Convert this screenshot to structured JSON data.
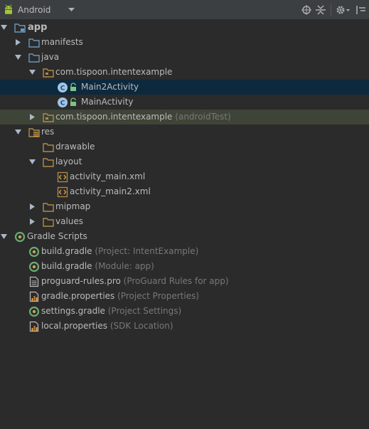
{
  "toolbar": {
    "view_selector": "Android",
    "icons": [
      "android-icon",
      "dropdown-arrow-icon",
      "scroll-to-source-icon",
      "collapse-all-icon",
      "settings-icon",
      "hide-icon"
    ]
  },
  "tree": {
    "app": "app",
    "manifests": "manifests",
    "java": "java",
    "pkg_main": "com.tispoon.intentexample",
    "main2activity": "Main2Activity",
    "mainactivity": "MainActivity",
    "pkg_test": "com.tispoon.intentexample",
    "pkg_test_hint": "(androidTest)",
    "res": "res",
    "drawable": "drawable",
    "layout": "layout",
    "activity_main": "activity_main.xml",
    "activity_main2": "activity_main2.xml",
    "mipmap": "mipmap",
    "values": "values",
    "gradle_scripts": "Gradle Scripts",
    "build_gradle_project": "build.gradle",
    "build_gradle_project_hint": "(Project: IntentExample)",
    "build_gradle_module": "build.gradle",
    "build_gradle_module_hint": "(Module: app)",
    "proguard": "proguard-rules.pro",
    "proguard_hint": "(ProGuard Rules for app)",
    "gradle_properties": "gradle.properties",
    "gradle_properties_hint": "(Project Properties)",
    "settings_gradle": "settings.gradle",
    "settings_gradle_hint": "(Project Settings)",
    "local_properties": "local.properties",
    "local_properties_hint": "(SDK Location)"
  },
  "colors": {
    "background": "#2b2b2b",
    "selection": "#0d293e",
    "test_highlight": "#3e4437",
    "text": "#bbbbbb",
    "hint": "#787878",
    "folder_blue": "#6897bb",
    "folder_tan": "#b08a48"
  }
}
